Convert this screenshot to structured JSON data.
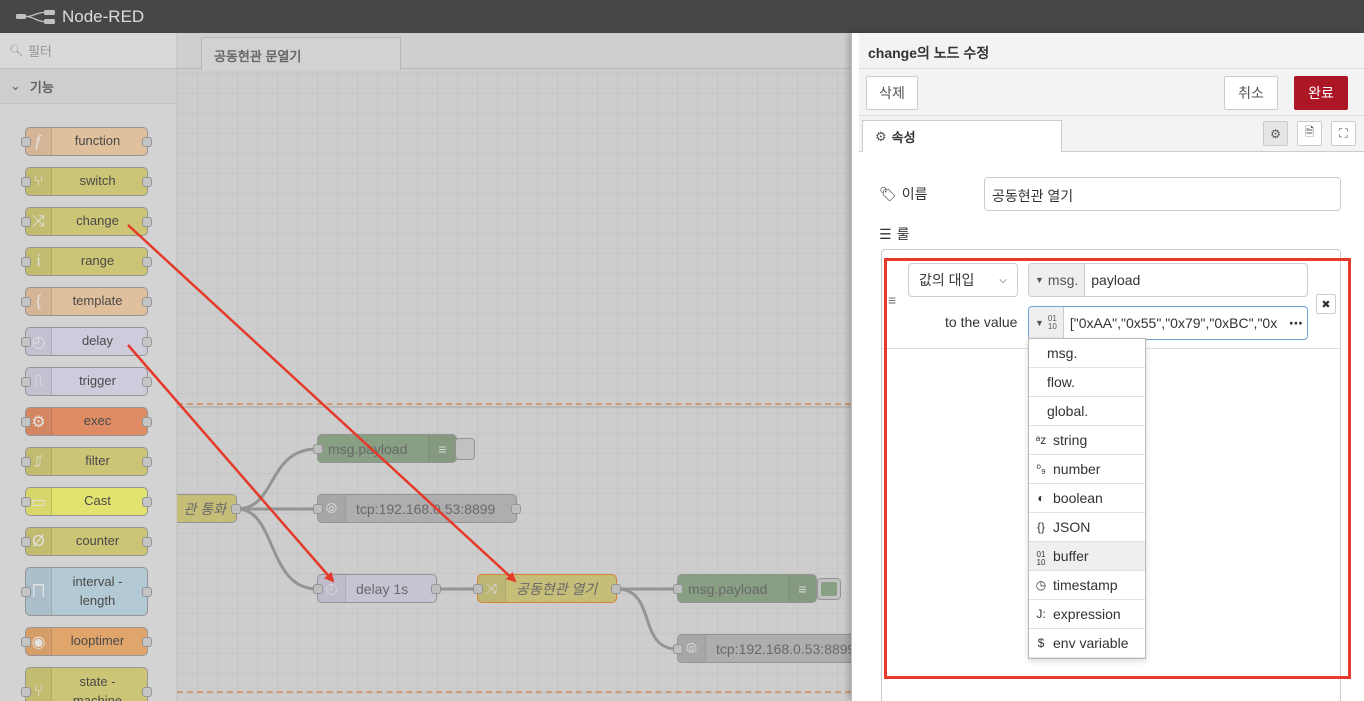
{
  "app": {
    "title": "Node-RED"
  },
  "palette": {
    "filter_placeholder": "필터",
    "category": "기능",
    "nodes": [
      {
        "label": "function",
        "color": "#fdd0a2",
        "icon": "function-icon"
      },
      {
        "label": "switch",
        "color": "#e2d96e",
        "icon": "switch-icon"
      },
      {
        "label": "change",
        "color": "#e2d96e",
        "icon": "shuffle-icon"
      },
      {
        "label": "range",
        "color": "#e2d96e",
        "icon": "range-icon"
      },
      {
        "label": "template",
        "color": "#fdd0a2",
        "icon": "braces-icon"
      },
      {
        "label": "delay",
        "color": "#e6e0f8",
        "icon": "timer-icon"
      },
      {
        "label": "trigger",
        "color": "#e6e0f8",
        "icon": "trigger-icon"
      },
      {
        "label": "exec",
        "color": "#fb8c59",
        "icon": "gear-icon"
      },
      {
        "label": "filter",
        "color": "#e2d96e",
        "icon": "filter-icon"
      },
      {
        "label": "Cast",
        "color": "#ffff66",
        "icon": "cast-icon"
      },
      {
        "label": "counter",
        "color": "#e2d96e",
        "icon": "counter-icon"
      },
      {
        "label": "interval -\nlength",
        "color": "#c0deed",
        "icon": "interval-icon"
      },
      {
        "label": "looptimer",
        "color": "#fdae61",
        "icon": "loop-icon"
      },
      {
        "label": "state -\nmachine",
        "color": "#e2d96e",
        "icon": "state-icon"
      }
    ]
  },
  "workspace": {
    "tab": "공동현관 문열기",
    "nodes": {
      "call": "관 통화",
      "debug1": "msg.payload",
      "tcp1": "tcp:192.168.0.53:8899",
      "delay": "delay 1s",
      "change": "공동현관 열기",
      "debug2": "msg.payload",
      "tcp2": "tcp:192.168.0.53:8899"
    }
  },
  "tray": {
    "title": "change의 노드 수정",
    "delete": "삭제",
    "cancel": "취소",
    "done": "완료",
    "tab": "속성",
    "name_label": "이름",
    "name_value": "공동현관 열기",
    "rules_label": "룰",
    "rule": {
      "action": "값의 대입",
      "target_type": "msg.",
      "target_value": "payload",
      "to_label": "to the value",
      "value_type": "buffer",
      "value": "[\"0xAA\",\"0x55\",\"0x79\",\"0xBC\",\"0x"
    },
    "type_menu": [
      {
        "label": "msg.",
        "icon": ""
      },
      {
        "label": "flow.",
        "icon": ""
      },
      {
        "label": "global.",
        "icon": ""
      },
      {
        "label": "string",
        "icon": "az-icon"
      },
      {
        "label": "number",
        "icon": "09-icon"
      },
      {
        "label": "boolean",
        "icon": "toggle-icon"
      },
      {
        "label": "JSON",
        "icon": "json-icon"
      },
      {
        "label": "buffer",
        "icon": "buffer-icon"
      },
      {
        "label": "timestamp",
        "icon": "clock-icon"
      },
      {
        "label": "expression",
        "icon": "expression-icon"
      },
      {
        "label": "env variable",
        "icon": "dollar-icon"
      }
    ]
  },
  "colors": {
    "accent": "#ad1625",
    "annotation": "#e53a2a"
  }
}
